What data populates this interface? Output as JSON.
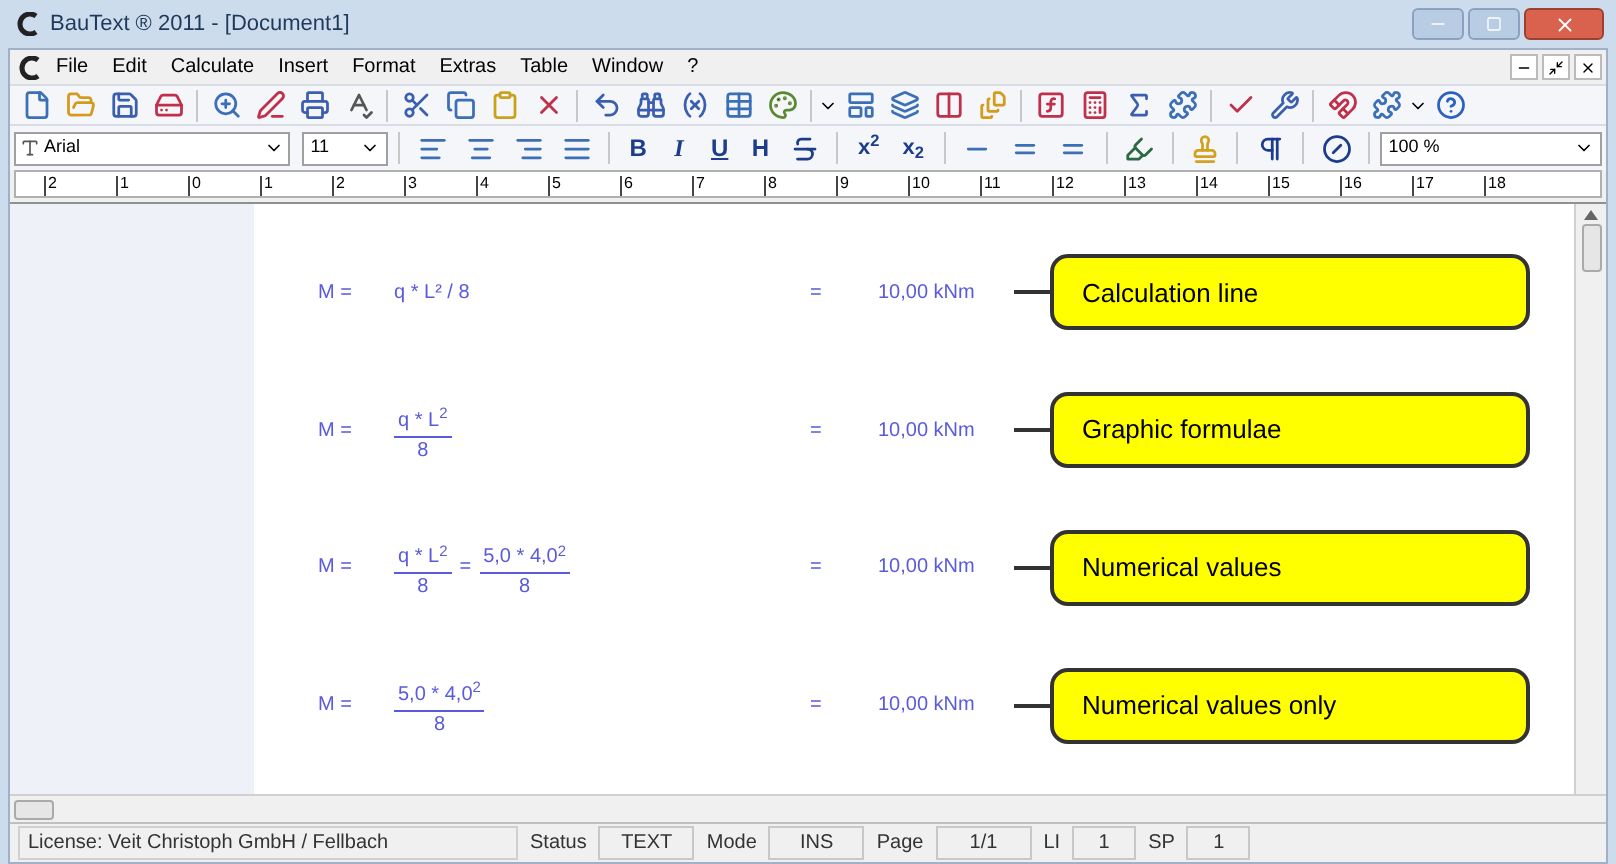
{
  "window": {
    "title": "BauText ® 2011 - [Document1]"
  },
  "menu": [
    "File",
    "Edit",
    "Calculate",
    "Insert",
    "Format",
    "Extras",
    "Table",
    "Window",
    "?"
  ],
  "format_bar": {
    "font": "Arial",
    "size": "11",
    "text_buttons": [
      "B",
      "I",
      "U",
      "H"
    ],
    "script_buttons": [
      "x$^{2}$",
      "x$_{2}$"
    ],
    "zoom": "100 %"
  },
  "ruler": [
    "2",
    "1",
    "0",
    "1",
    "2",
    "3",
    "4",
    "5",
    "6",
    "7",
    "8",
    "9",
    "10",
    "11",
    "12",
    "13",
    "14",
    "15",
    "16",
    "17",
    "18"
  ],
  "rows": [
    {
      "lhs": "M =",
      "terms": [
        {
          "kind": "text",
          "text": "q * L² / 8"
        }
      ],
      "eq": "=",
      "result": "10,00 kNm",
      "callout": "Calculation line"
    },
    {
      "lhs": "M =",
      "terms": [
        {
          "kind": "fraction",
          "numerator": "q * L$^{2}$",
          "denominator": "8"
        }
      ],
      "eq": "=",
      "result": "10,00 kNm",
      "callout": "Graphic formulae"
    },
    {
      "lhs": "M =",
      "terms": [
        {
          "kind": "fraction",
          "numerator": "q * L$^{2}$",
          "denominator": "8"
        },
        {
          "kind": "text",
          "text": "="
        },
        {
          "kind": "fraction",
          "numerator": "5,0 * 4,0$^{2}$",
          "denominator": "8"
        }
      ],
      "eq": "=",
      "result": "10,00 kNm",
      "callout": "Numerical values"
    },
    {
      "lhs": "M =",
      "terms": [
        {
          "kind": "fraction",
          "numerator": "5,0 * 4,0$^{2}$",
          "denominator": "8"
        }
      ],
      "eq": "=",
      "result": "10,00 kNm",
      "callout": "Numerical values only"
    }
  ],
  "status_bar": [
    {
      "kind": "label",
      "text": "License: Veit Christoph GmbH / Fellbach"
    },
    {
      "kind": "label",
      "text": "Status"
    },
    {
      "kind": "field",
      "text": "TEXT"
    },
    {
      "kind": "label",
      "text": "Mode"
    },
    {
      "kind": "field",
      "text": "INS"
    },
    {
      "kind": "label",
      "text": "Page"
    },
    {
      "kind": "field",
      "text": "1/1"
    },
    {
      "kind": "label",
      "text": "LI"
    },
    {
      "kind": "field",
      "text": "1"
    },
    {
      "kind": "label",
      "text": "SP"
    },
    {
      "kind": "field",
      "text": "1"
    }
  ]
}
